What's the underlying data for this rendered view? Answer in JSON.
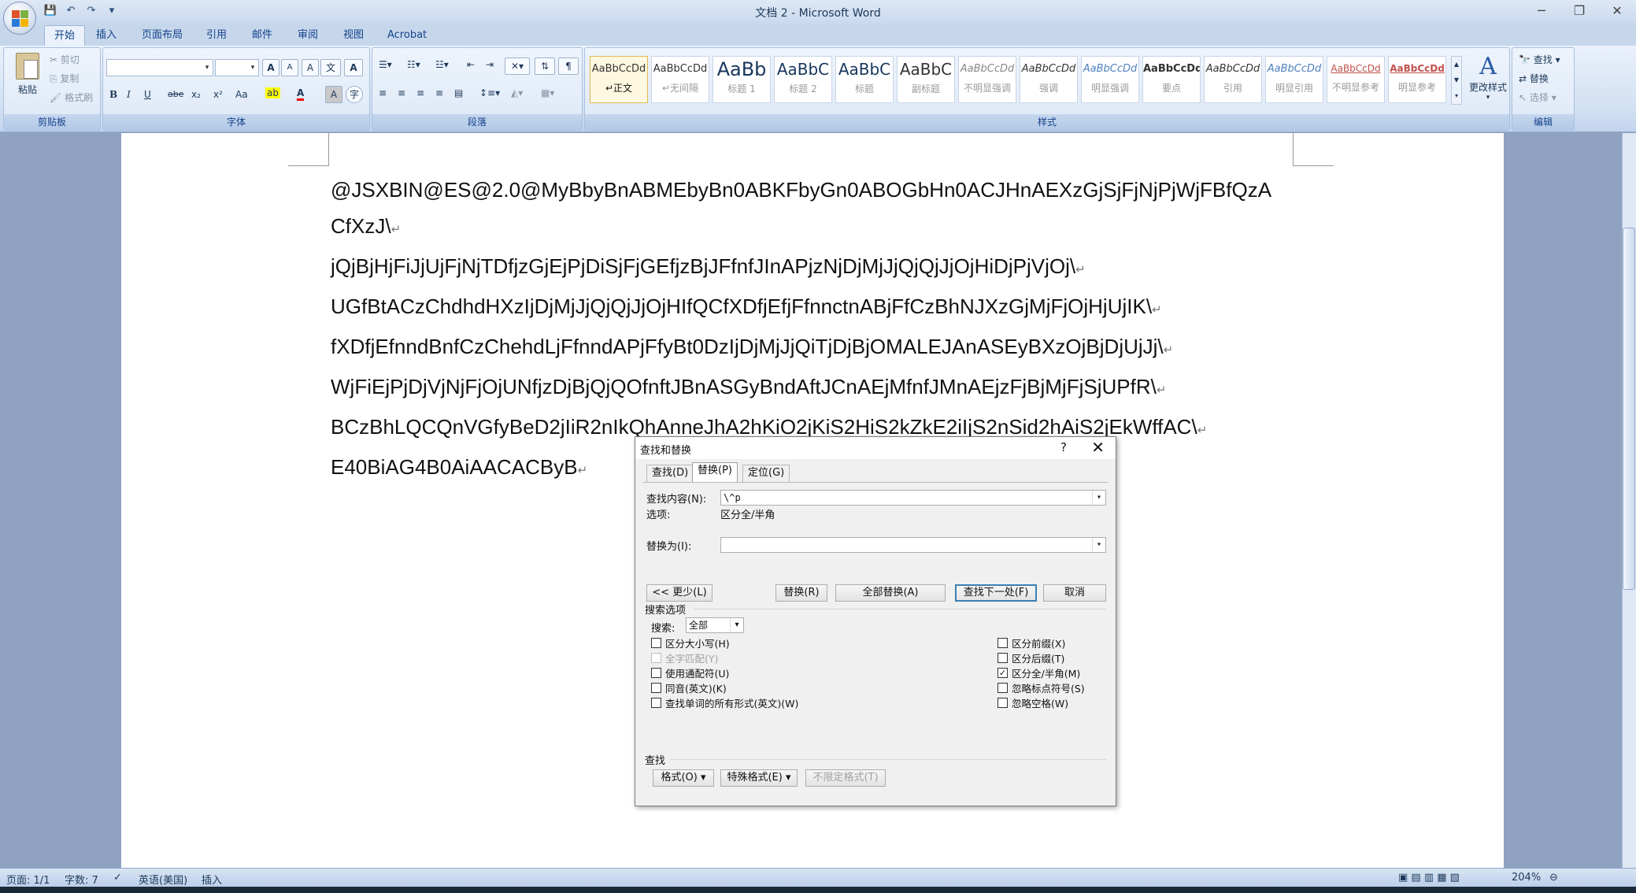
{
  "window": {
    "title": "文档 2 - Microsoft Word",
    "controls": {
      "minimize": "─",
      "restore": "❐",
      "close": "✕"
    }
  },
  "qat": {
    "save": "💾",
    "undo": "↶",
    "redo": "↷",
    "more": "▾"
  },
  "tabs": [
    "开始",
    "插入",
    "页面布局",
    "引用",
    "邮件",
    "审阅",
    "视图",
    "Acrobat"
  ],
  "ribbon": {
    "clipboard": {
      "label": "剪贴板",
      "paste": "粘贴",
      "cut": "剪切",
      "copy": "复制",
      "format_painter": "格式刷"
    },
    "font": {
      "label": "字体",
      "font_name": "",
      "font_size": "",
      "bold": "B",
      "italic": "I",
      "underline": "U",
      "strike": "abe",
      "subscript": "x₂",
      "superscript": "x²",
      "change_case": "Aa",
      "grow": "A",
      "shrink": "A",
      "clear": "A",
      "highlight": "ab",
      "font_color": "A",
      "char_shading": "A",
      "enclose": "字"
    },
    "paragraph": {
      "label": "段落"
    },
    "styles": {
      "label": "样式",
      "items": [
        {
          "sample": "AaBbCcDd",
          "name": "↵正文",
          "active": true
        },
        {
          "sample": "AaBbCcDd",
          "name": "↵无间隔"
        },
        {
          "sample": "AaBb",
          "name": "标题 1"
        },
        {
          "sample": "AaBbC",
          "name": "标题 2"
        },
        {
          "sample": "AaBbC",
          "name": "标题"
        },
        {
          "sample": "AaBbC",
          "name": "副标题"
        },
        {
          "sample": "AaBbCcDd",
          "name": "不明显强调"
        },
        {
          "sample": "AaBbCcDd",
          "name": "强调"
        },
        {
          "sample": "AaBbCcDd",
          "name": "明显强调"
        },
        {
          "sample": "AaBbCcDd",
          "name": "要点"
        },
        {
          "sample": "AaBbCcDd",
          "name": "引用"
        },
        {
          "sample": "AaBbCcDd",
          "name": "明显引用"
        },
        {
          "sample": "AaBbCcDd",
          "name": "不明显参考"
        },
        {
          "sample": "AaBbCcDd",
          "name": "明显参考"
        }
      ],
      "change_styles": "更改样式"
    },
    "editing": {
      "label": "编辑",
      "find": "查找",
      "replace": "替换",
      "select": "选择"
    }
  },
  "document": {
    "lines": [
      "@JSXBIN@ES@2.0@MyBbyBnABMEbyBn0ABKFbyGn0ABOGbHn0ACJHnAEXzGjSjFjNjPjWjFBfQzA",
      "CfXzJ\\",
      "jQjBjHjFiJjUjFjNjTDfjzGjEjPjDiSjFjGEfjzBjJFfnfJInAPjzNjDjMjJjQjQjJjOjHiDjPjVjOj\\",
      "UGfBtACzChdhdHXzIjDjMjJjQjQjJjOjHIfQCfXDfjEfjFfnnctnABjFfCzBhNJXzGjMjFjOjHjUjIK\\",
      "fXDfjEfnndBnfCzChehdLjFfnndAPjFfyBt0DzIjDjMjJjQiTjDjBjOMALEJAnASEyBXzOjBjDjUjJj\\",
      "WjFiEjPjDjVjNjFjOjUNfjzDjBjQjQOfnftJBnASGyBndAftJCnAEjMfnfJMnAEjzFjBjMjFjSjUPfR\\",
      "BCzBhLQCQnVGfyBeD2jIiR2nIkQhAnneJhA2hKiO2jKiS2HiS2kZkE2iIjS2nSid2hAiS2jEkWffAC\\",
      "E40BiAG4B0AiAACACByB"
    ],
    "pilcrow": "↵"
  },
  "status": {
    "page": "页面: 1/1",
    "words": "字数: 7",
    "language": "英语(美国)",
    "mode": "插入",
    "zoom": "204%"
  },
  "dialog": {
    "title": "查找和替换",
    "help": "?",
    "close": "✕",
    "tabs": [
      "查找(D)",
      "替换(P)",
      "定位(G)"
    ],
    "active_tab": 1,
    "find_label": "查找内容(N):",
    "find_value": "\\^p",
    "options_label": "选项:",
    "options_value": "区分全/半角",
    "replace_label": "替换为(I):",
    "replace_value": "",
    "buttons": {
      "less": "<< 更少(L)",
      "replace": "替换(R)",
      "replace_all": "全部替换(A)",
      "find_next": "查找下一处(F)",
      "cancel": "取消"
    },
    "search_options_label": "搜索选项",
    "search_label": "搜索:",
    "search_value": "全部",
    "left_checks": [
      {
        "label": "区分大小写(H)",
        "checked": false,
        "disabled": false
      },
      {
        "label": "全字匹配(Y)",
        "checked": false,
        "disabled": true
      },
      {
        "label": "使用通配符(U)",
        "checked": false,
        "disabled": false
      },
      {
        "label": "同音(英文)(K)",
        "checked": false,
        "disabled": false
      },
      {
        "label": "查找单词的所有形式(英文)(W)",
        "checked": false,
        "disabled": false
      }
    ],
    "right_checks": [
      {
        "label": "区分前缀(X)",
        "checked": false
      },
      {
        "label": "区分后缀(T)",
        "checked": false
      },
      {
        "label": "区分全/半角(M)",
        "checked": true
      },
      {
        "label": "忽略标点符号(S)",
        "checked": false
      },
      {
        "label": "忽略空格(W)",
        "checked": false
      }
    ],
    "find_section_label": "查找",
    "bottom_buttons": {
      "format": "格式(O) ▾",
      "special": "特殊格式(E) ▾",
      "no_format": "不限定格式(T)"
    }
  }
}
